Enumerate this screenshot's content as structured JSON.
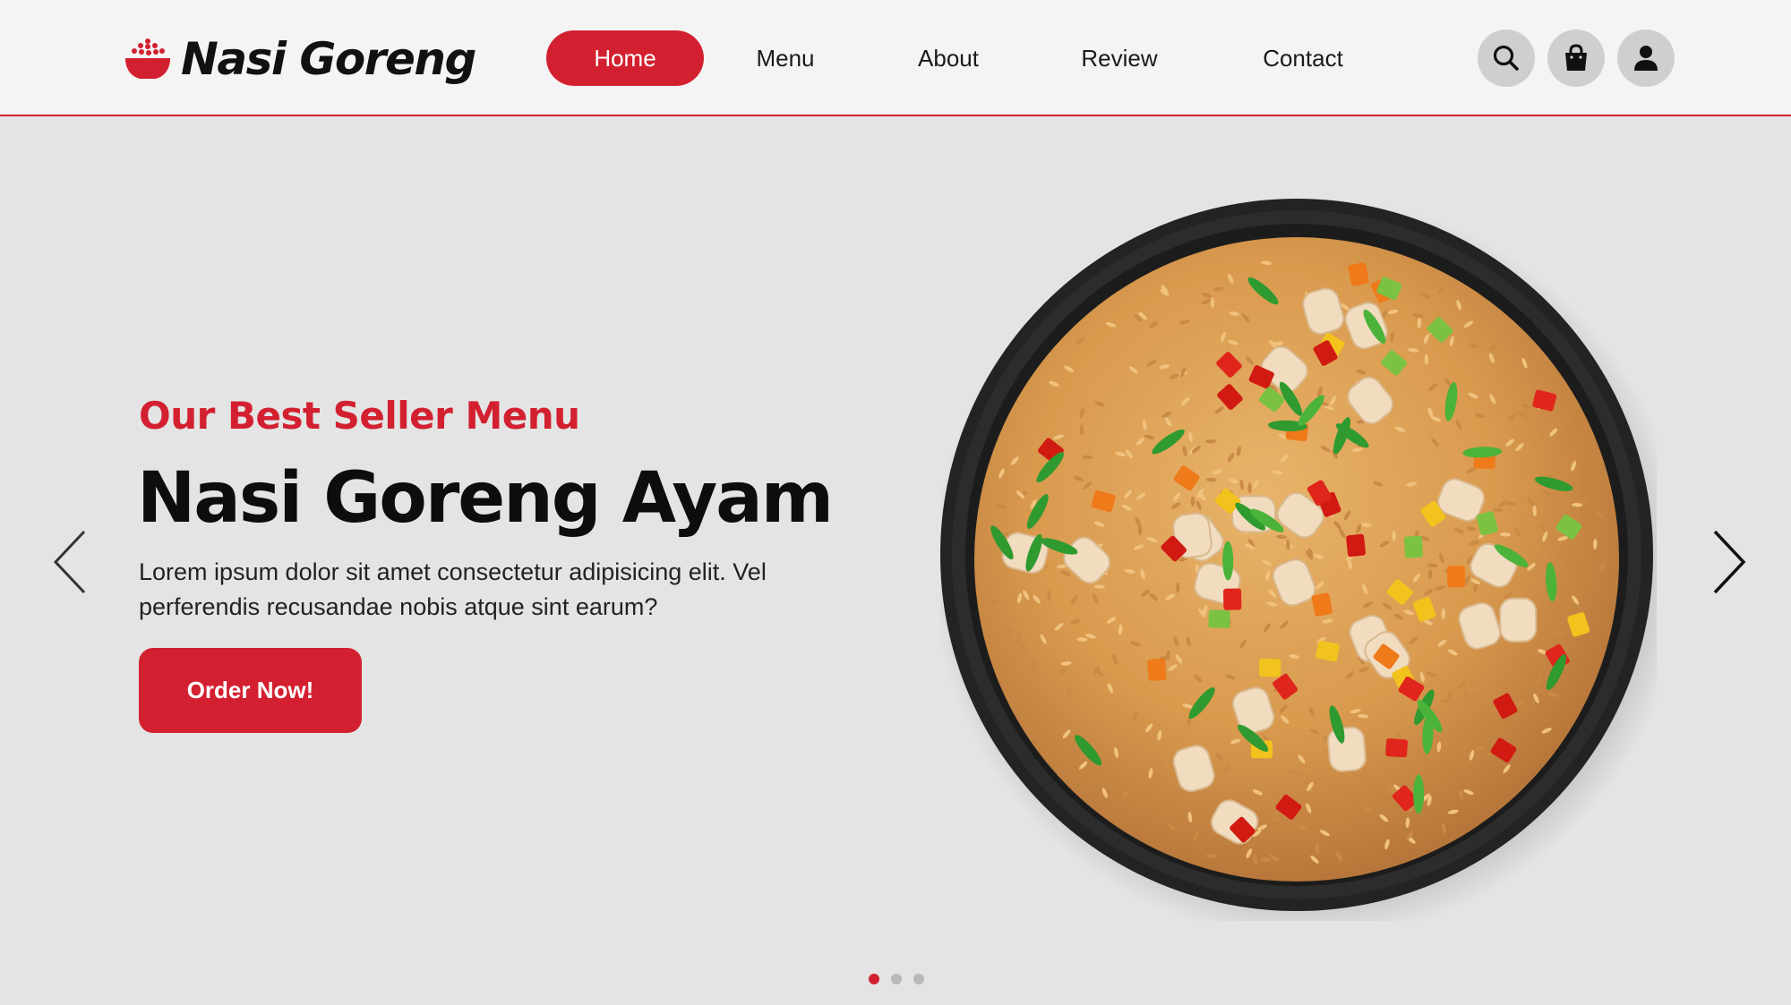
{
  "brand": {
    "name": "Nasi Goreng"
  },
  "nav": {
    "items": [
      {
        "label": "Home",
        "active": true
      },
      {
        "label": "Menu",
        "active": false
      },
      {
        "label": "About",
        "active": false
      },
      {
        "label": "Review",
        "active": false
      },
      {
        "label": "Contact",
        "active": false
      }
    ]
  },
  "header_icons": [
    "search-icon",
    "shopping-bag-icon",
    "user-icon"
  ],
  "hero": {
    "subtitle": "Our Best Seller Menu",
    "title": "Nasi Goreng Ayam",
    "description": "Lorem ipsum dolor sit amet consectetur adipisicing elit. Vel perferendis recusandae nobis atque sint earum?",
    "cta_label": "Order Now!"
  },
  "carousel": {
    "slide_count": 3,
    "active_slide": 1
  },
  "colors": {
    "accent": "#d32030",
    "background": "#e4e4e4",
    "header_background": "#f4f4f4",
    "icon_button": "#cfcfcf"
  }
}
